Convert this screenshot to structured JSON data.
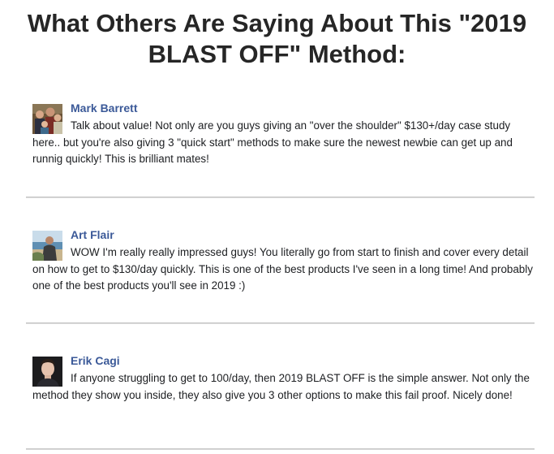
{
  "page": {
    "title_line1": "What Others Are Saying About This \"2019",
    "title_line2": "BLAST OFF\" Method:"
  },
  "testimonials": [
    {
      "name": "Mark Barrett",
      "comment": "Talk about value! Not only are you guys giving an \"over the shoulder\" $130+/day case study here.. but you're also giving 3 \"quick start\" methods to make sure the newest newbie can get up and runnig quickly! This is brilliant mates!",
      "avatar": "group-photo-avatar"
    },
    {
      "name": "Art Flair",
      "comment": "WOW I'm really really impressed guys! You literally go from start to finish and cover every detail on how to get to $130/day quickly. This is one of the best products I've seen in a long time! And probably one of the best products you'll see in 2019 :)",
      "avatar": "beach-photo-avatar"
    },
    {
      "name": "Erik Cagi",
      "comment": "If anyone struggling to get to 100/day, then 2019 BLAST OFF is the simple answer. Not only the method they show you inside, they also give you 3 other options to make this fail proof. Nicely done!",
      "avatar": "portrait-photo-avatar"
    }
  ],
  "colors": {
    "name_link": "#3b5998",
    "title_text": "#262626",
    "divider": "#c7c7c7"
  }
}
